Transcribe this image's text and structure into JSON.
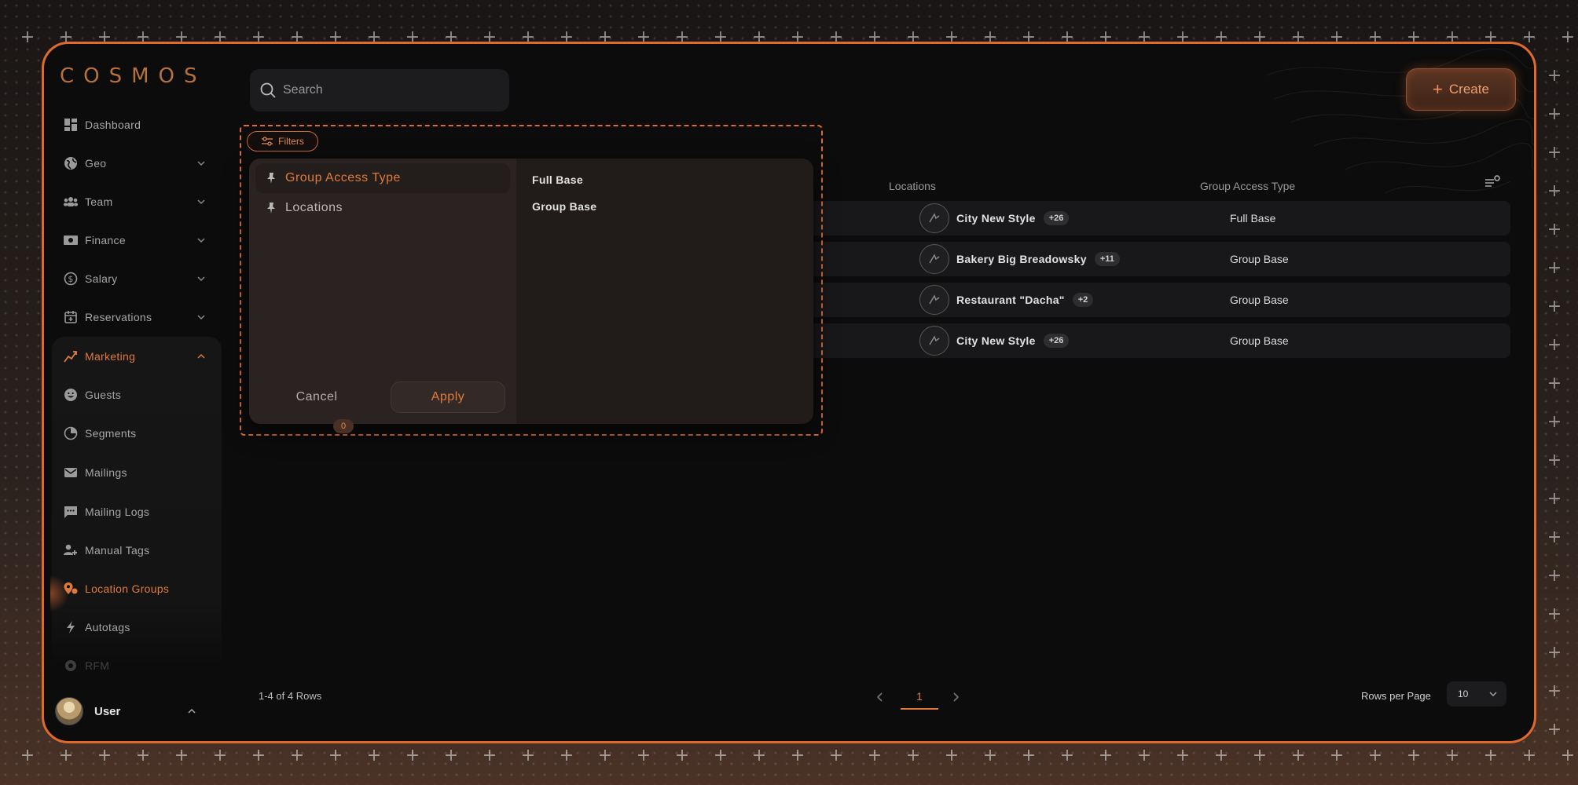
{
  "brand": {
    "logo": "COSMOS",
    "accent": "#e06a2c"
  },
  "sidebar": {
    "items": [
      {
        "label": "Dashboard",
        "icon": "dashboard-icon"
      },
      {
        "label": "Geo",
        "icon": "globe-icon"
      },
      {
        "label": "Team",
        "icon": "team-icon"
      },
      {
        "label": "Finance",
        "icon": "finance-icon"
      },
      {
        "label": "Salary",
        "icon": "salary-icon"
      },
      {
        "label": "Reservations",
        "icon": "reservations-icon"
      },
      {
        "label": "Marketing",
        "icon": "marketing-icon"
      }
    ],
    "submenu": [
      {
        "label": "Guests",
        "icon": "guests-icon"
      },
      {
        "label": "Segments",
        "icon": "segments-icon"
      },
      {
        "label": "Mailings",
        "icon": "mail-icon"
      },
      {
        "label": "Mailing Logs",
        "icon": "chat-icon"
      },
      {
        "label": "Manual Tags",
        "icon": "manual-tags-icon"
      },
      {
        "label": "Location Groups",
        "icon": "location-pin-icon"
      },
      {
        "label": "Autotags",
        "icon": "bolt-icon"
      },
      {
        "label": "RFM",
        "icon": "rfm-icon"
      }
    ],
    "user": {
      "name": "User"
    }
  },
  "search": {
    "placeholder": "Search"
  },
  "create_label": "Create",
  "table": {
    "columns": {
      "locations": "Locations",
      "group_access_type": "Group Access Type"
    },
    "rows": [
      {
        "location": "City New Style",
        "more": "+26",
        "access": "Full Base"
      },
      {
        "location": "Bakery Big Breadowsky",
        "more": "+11",
        "access": "Group Base"
      },
      {
        "location": "Restaurant \"Dacha\"",
        "more": "+2",
        "access": "Group Base"
      },
      {
        "location": "City New Style",
        "more": "+26",
        "access": "Group Base"
      }
    ]
  },
  "footer": {
    "rows_info": "1-4  of  4 Rows",
    "page": "1",
    "rows_per_page_label": "Rows per Page",
    "rows_per_page": "10"
  },
  "filters": {
    "chip_label": "Filters",
    "categories": [
      "Group Access Type",
      "Locations"
    ],
    "options": [
      "Full Base",
      "Group Base"
    ],
    "cancel_label": "Cancel",
    "apply_label": "Apply",
    "apply_count": "0"
  }
}
